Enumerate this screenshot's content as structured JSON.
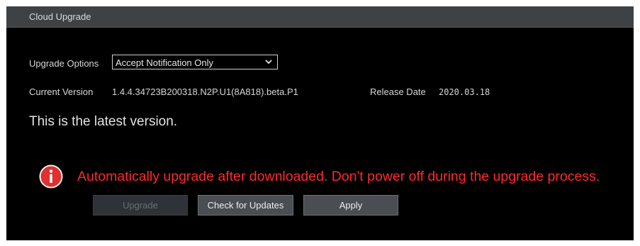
{
  "window": {
    "title": "Cloud Upgrade"
  },
  "upgrade_options": {
    "label": "Upgrade Options",
    "selected": "Accept Notification Only"
  },
  "version_info": {
    "current_version_label": "Current Version",
    "current_version_value": "1.4.4.34723B200318.N2P.U1(8A818).beta.P1",
    "release_date_label": "Release Date",
    "release_date_value": "2020.03.18"
  },
  "status": {
    "message": "This is the latest version."
  },
  "warning": {
    "icon": "info-circle-icon",
    "text": "Automatically upgrade after downloaded. Don't power off during the upgrade process.",
    "color": "#ff2a2a"
  },
  "buttons": {
    "upgrade_label": "Upgrade",
    "check_label": "Check for Updates",
    "apply_label": "Apply"
  }
}
